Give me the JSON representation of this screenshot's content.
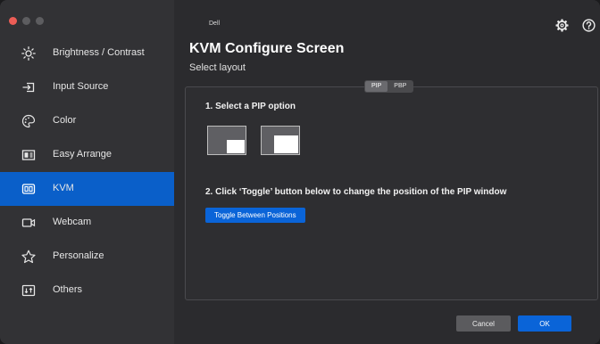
{
  "sidebar": {
    "items": [
      {
        "label": "Brightness / Contrast",
        "icon": "sun-icon"
      },
      {
        "label": "Input Source",
        "icon": "input-source-icon"
      },
      {
        "label": "Color",
        "icon": "palette-icon"
      },
      {
        "label": "Easy Arrange",
        "icon": "easy-arrange-icon"
      },
      {
        "label": "KVM",
        "icon": "kvm-icon",
        "active": true
      },
      {
        "label": "Webcam",
        "icon": "webcam-icon"
      },
      {
        "label": "Personalize",
        "icon": "star-icon"
      },
      {
        "label": "Others",
        "icon": "others-icon"
      }
    ]
  },
  "header": {
    "brand": "Dell",
    "title": "KVM Configure Screen",
    "subtitle": "Select layout"
  },
  "layout_toggle": {
    "pip_label": "PIP",
    "pbp_label": "PBP",
    "selected": "PIP"
  },
  "step1": {
    "text": "1. Select a PIP option"
  },
  "step2": {
    "text": "2. Click ‘Toggle’ button below to change the position of the PIP window",
    "button_label": "Toggle Between Positions"
  },
  "footer": {
    "cancel_label": "Cancel",
    "ok_label": "OK"
  },
  "colors": {
    "accent": "#0a64d8",
    "sidebar_bg": "#323235",
    "main_bg": "#2b2b2e"
  }
}
